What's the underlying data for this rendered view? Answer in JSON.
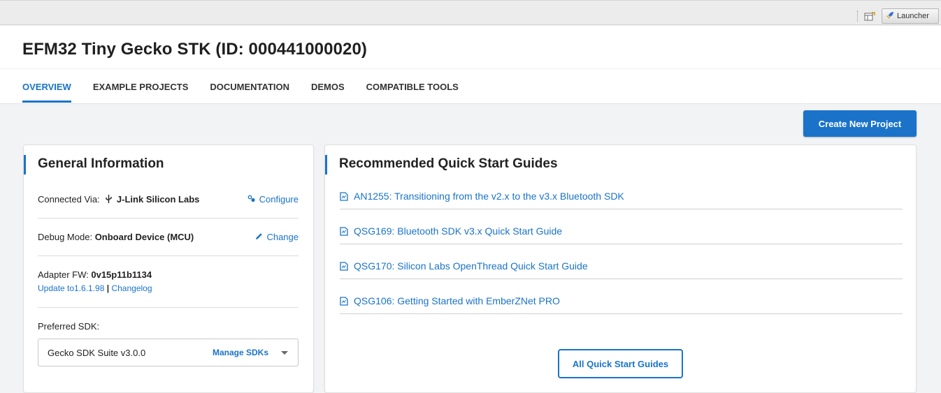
{
  "toolbar": {
    "launcher_label": "Launcher"
  },
  "page": {
    "title": "EFM32 Tiny Gecko STK (ID: 000441000020)"
  },
  "tabs": [
    {
      "label": "OVERVIEW",
      "active": true
    },
    {
      "label": "EXAMPLE PROJECTS",
      "active": false
    },
    {
      "label": "DOCUMENTATION",
      "active": false
    },
    {
      "label": "DEMOS",
      "active": false
    },
    {
      "label": "COMPATIBLE TOOLS",
      "active": false
    }
  ],
  "actions": {
    "create_project_label": "Create New Project"
  },
  "general_info": {
    "title": "General Information",
    "connected_via_label": "Connected Via:",
    "connected_via_value": "J-Link Silicon Labs",
    "configure_label": "Configure",
    "debug_mode_label": "Debug Mode:",
    "debug_mode_value": "Onboard Device (MCU)",
    "change_label": "Change",
    "adapter_fw_label": "Adapter FW:",
    "adapter_fw_value": "0v15p11b1134",
    "update_link": "Update to1.6.1.98",
    "link_separator": "|",
    "changelog_link": "Changelog",
    "preferred_sdk_label": "Preferred SDK:",
    "sdk_value": "Gecko SDK Suite v3.0.0",
    "manage_sdks_label": "Manage SDKs"
  },
  "quick_start": {
    "title": "Recommended Quick Start Guides",
    "guides": [
      "AN1255: Transitioning from the v2.x to the v3.x Bluetooth SDK",
      "QSG169: Bluetooth SDK v3.x Quick Start Guide",
      "QSG170: Silicon Labs OpenThread Quick Start Guide",
      "QSG106: Getting Started with EmberZNet PRO"
    ],
    "all_guides_label": "All Quick Start Guides"
  },
  "colors": {
    "accent": "#1a73c9",
    "background": "#f2f3f5"
  }
}
